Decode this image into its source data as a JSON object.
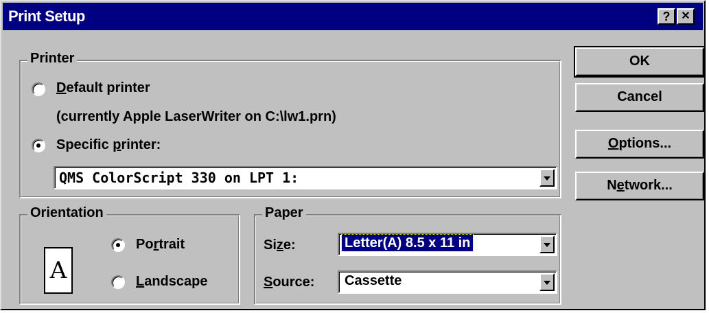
{
  "window": {
    "title": "Print Setup",
    "help_glyph": "?",
    "close_glyph": "✕"
  },
  "printer": {
    "group_label": "Printer",
    "default_option": {
      "accel": "D",
      "rest": "efault printer",
      "selected": false
    },
    "current_text": "(currently Apple LaserWriter on C:\\lw1.prn)",
    "specific_option": {
      "accel": "p",
      "pre": "Specific ",
      "rest": "rinter:",
      "selected": true
    },
    "specific_value": "QMS ColorScript 330 on LPT 1:"
  },
  "orientation": {
    "group_label": "Orientation",
    "icon_letter": "A",
    "portrait": {
      "pre": "Po",
      "accel": "r",
      "rest": "trait",
      "selected": true
    },
    "landscape": {
      "accel": "L",
      "rest": "andscape",
      "selected": false
    }
  },
  "paper": {
    "group_label": "Paper",
    "size_label": {
      "pre": "Si",
      "accel": "z",
      "rest": "e:"
    },
    "size_value": "Letter(A) 8.5 x 11 in",
    "source_label": {
      "accel": "S",
      "rest": "ource:"
    },
    "source_value": "Cassette"
  },
  "buttons": {
    "ok": "OK",
    "cancel": "Cancel",
    "options": {
      "accel": "O",
      "rest": "ptions..."
    },
    "network": {
      "pre": "N",
      "accel": "e",
      "rest": "twork..."
    }
  }
}
